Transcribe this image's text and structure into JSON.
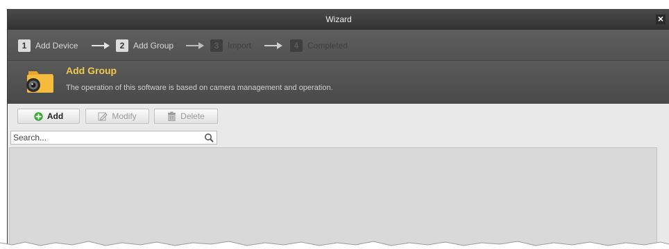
{
  "window": {
    "title": "Wizard",
    "close_glyph": "×",
    "close_icon": "close-icon"
  },
  "steps": [
    {
      "number": "1",
      "label": "Add Device",
      "state": "done"
    },
    {
      "number": "2",
      "label": "Add Group",
      "state": "current"
    },
    {
      "number": "3",
      "label": "Import",
      "state": "pending"
    },
    {
      "number": "4",
      "label": "Completed",
      "state": "pending"
    }
  ],
  "header": {
    "icon": "camera-folder-icon",
    "title": "Add Group",
    "description": "The operation of this software is based on camera management and operation."
  },
  "toolbar": {
    "add_label": "Add",
    "add_icon": "plus-circle-icon",
    "modify_label": "Modify",
    "modify_icon": "pencil-icon",
    "delete_label": "Delete",
    "delete_icon": "trash-icon"
  },
  "search": {
    "placeholder": "Search...",
    "value": "",
    "icon": "search-icon"
  },
  "colors": {
    "accent_title": "#f2c94c",
    "add_icon_green": "#3aa635",
    "titlebar": "#3c3c3c",
    "header_bg": "#525252"
  }
}
